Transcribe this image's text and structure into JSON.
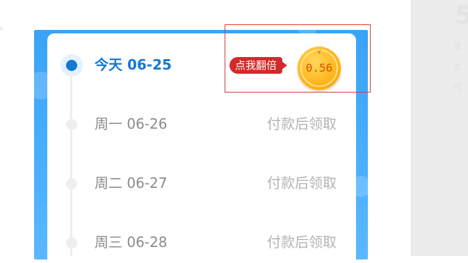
{
  "side_panel": {
    "ghost_number": "5",
    "ghost_lines": [
      "活",
      "支",
      "付"
    ]
  },
  "days": [
    {
      "label": "今天 06-25",
      "active": true
    },
    {
      "label": "周一 06-26",
      "status": "付款后领取"
    },
    {
      "label": "周二 06-27",
      "status": "付款后领取"
    },
    {
      "label": "周三 06-28",
      "status": "付款后领取"
    }
  ],
  "reward": {
    "double_label": "点我翻倍",
    "currency_symbol": "¥",
    "amount": "0.56"
  },
  "colors": {
    "accent": "#1478d4",
    "frame": "#4aafff",
    "tag": "#d22a2a",
    "coin": "#ffb51a"
  },
  "icons": {
    "coin": "gold-coin-icon",
    "timeline_dot": "timeline-dot-icon"
  }
}
